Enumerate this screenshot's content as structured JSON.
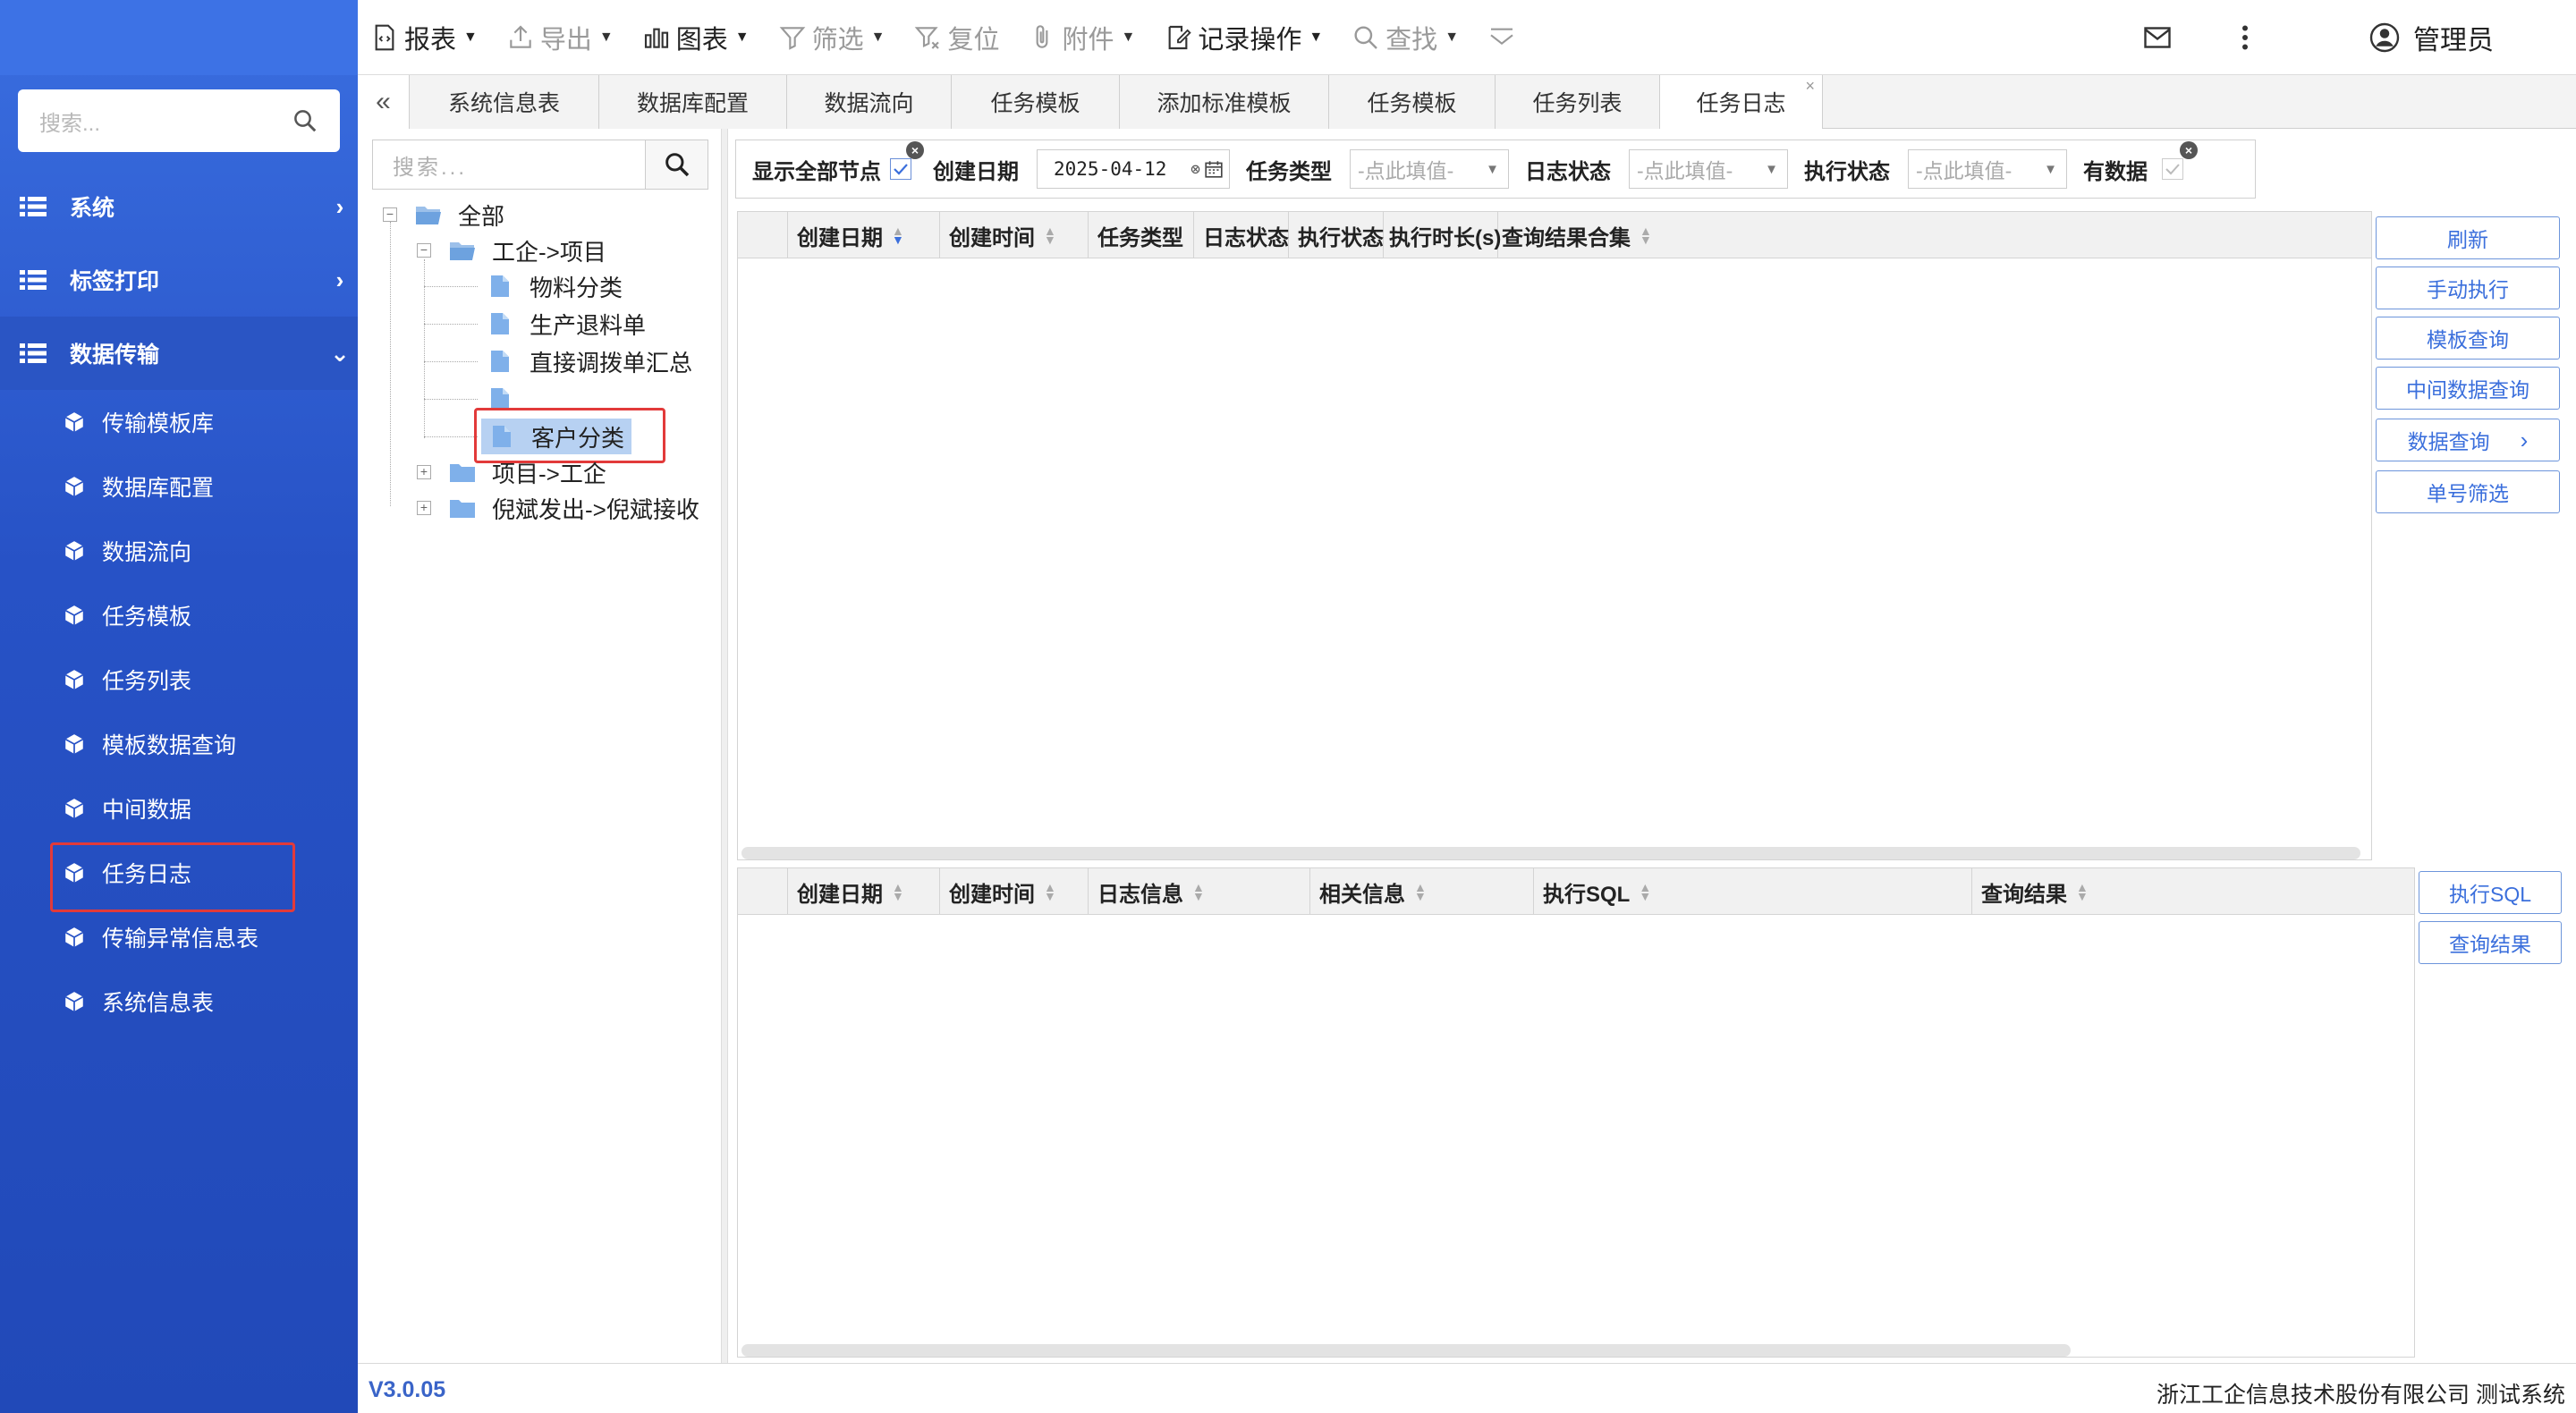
{
  "sidebar": {
    "search_placeholder": "搜索...",
    "groups": [
      {
        "label": "系统"
      },
      {
        "label": "标签打印"
      },
      {
        "label": "数据传输"
      }
    ],
    "items": [
      {
        "label": "传输模板库"
      },
      {
        "label": "数据库配置"
      },
      {
        "label": "数据流向"
      },
      {
        "label": "任务模板"
      },
      {
        "label": "任务列表"
      },
      {
        "label": "模板数据查询"
      },
      {
        "label": "中间数据"
      },
      {
        "label": "任务日志"
      },
      {
        "label": "传输异常信息表"
      },
      {
        "label": "系统信息表"
      }
    ],
    "version": "V3.0.05"
  },
  "toolbar": {
    "report": "报表",
    "export": "导出",
    "chart": "图表",
    "filter": "筛选",
    "reset": "复位",
    "attachment": "附件",
    "record_ops": "记录操作",
    "find": "查找",
    "user": "管理员"
  },
  "tabs": [
    "系统信息表",
    "数据库配置",
    "数据流向",
    "任务模板",
    "添加标准模板",
    "任务模板",
    "任务列表",
    "任务日志"
  ],
  "tree": {
    "search_placeholder": "搜索...",
    "root": "全部",
    "nodes": [
      "工企->项目",
      "物料分类",
      "生产退料单",
      "直接调拨单汇总",
      "",
      "客户分类",
      "项目->工企",
      "倪斌发出->倪斌接收"
    ]
  },
  "filters": {
    "show_all_nodes": "显示全部节点",
    "create_date": "创建日期",
    "date_value": "2025-04-12",
    "task_type": "任务类型",
    "task_type_placeholder": "-点此填值-",
    "log_status": "日志状态",
    "log_status_placeholder": "-点此填值-",
    "exec_status": "执行状态",
    "exec_status_placeholder": "-点此填值-",
    "has_data": "有数据"
  },
  "grid_top": {
    "columns": [
      "创建日期",
      "创建时间",
      "任务类型",
      "日志状态",
      "执行状态",
      "执行时长(s)",
      "查询结果合集"
    ]
  },
  "grid_bottom": {
    "columns": [
      "创建日期",
      "创建时间",
      "日志信息",
      "相关信息",
      "执行SQL",
      "查询结果"
    ]
  },
  "side_buttons": {
    "refresh": "刷新",
    "manual_exec": "手动执行",
    "template_query": "模板查询",
    "middle_data_query": "中间数据查询",
    "data_query": "数据查询",
    "number_filter": "单号筛选",
    "exec_sql": "执行SQL",
    "query_result": "查询结果"
  },
  "status": {
    "company": "浙江工企信息技术股份有限公司 测试系统"
  },
  "colors": {
    "sidebar_blue": "#2752c6",
    "accent": "#3b6fdc",
    "highlight_red": "#e23a3a"
  }
}
